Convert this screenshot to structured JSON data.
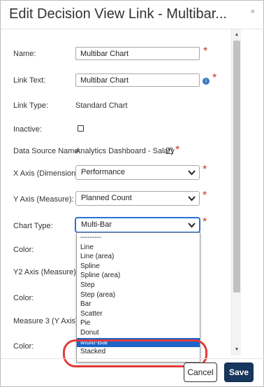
{
  "dialog": {
    "title": "Edit Decision View Link - Multibar...",
    "close_glyph": "×"
  },
  "form": {
    "name": {
      "label": "Name:",
      "value": "Multibar Chart"
    },
    "link_text": {
      "label": "Link Text:",
      "value": "Multibar Chart"
    },
    "link_type": {
      "label": "Link Type:",
      "value": "Standard Chart"
    },
    "inactive": {
      "label": "Inactive:",
      "checked": false
    },
    "data_source": {
      "label": "Data Source Name:",
      "value": "Analytics Dashboard - Salary"
    },
    "x_axis": {
      "label": "X Axis (Dimension):",
      "value": "Performance"
    },
    "y_axis": {
      "label": "Y Axis (Measure):",
      "value": "Planned Count"
    },
    "chart_type": {
      "label": "Chart Type:",
      "value": "Multi-Bar"
    },
    "color1": {
      "label": "Color:"
    },
    "y2_axis": {
      "label": "Y2 Axis (Measure):"
    },
    "color2": {
      "label": "Color:"
    },
    "measure3": {
      "label": "Measure 3 (Y Axis):"
    },
    "color3": {
      "label": "Color:"
    },
    "required_mark": "*"
  },
  "chart_type_options": [
    "---------",
    "Line",
    "Line (area)",
    "Spline",
    "Spline (area)",
    "Step",
    "Step (area)",
    "Bar",
    "Scatter",
    "Pie",
    "Donut",
    "Multi-Bar",
    "Stacked"
  ],
  "selected_option_index": 11,
  "buttons": {
    "cancel": "Cancel",
    "save": "Save"
  },
  "colors": {
    "required": "#c0392b",
    "selected_option": "#1e64c8",
    "save_button": "#16365c",
    "highlight_ring": "#e23b3b"
  },
  "icons": {
    "info": "info-icon",
    "chevron": "chevron-down-icon",
    "close": "close-icon"
  }
}
